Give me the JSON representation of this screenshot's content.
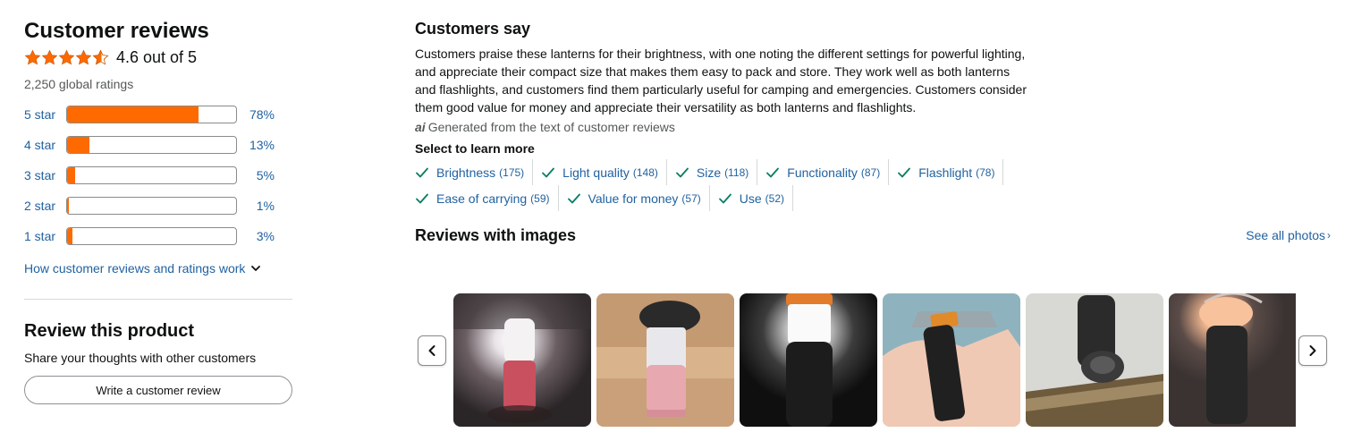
{
  "customer_reviews": {
    "title": "Customer reviews",
    "rating_text": "4.6 out of 5",
    "rating_value": 4.6,
    "global_ratings": "2,250 global ratings",
    "histogram": [
      {
        "label": "5 star",
        "pct": "78%",
        "value": 78
      },
      {
        "label": "4 star",
        "pct": "13%",
        "value": 13
      },
      {
        "label": "3 star",
        "pct": "5%",
        "value": 5
      },
      {
        "label": "2 star",
        "pct": "1%",
        "value": 1
      },
      {
        "label": "1 star",
        "pct": "3%",
        "value": 3
      }
    ],
    "how_link": "How customer reviews and ratings work"
  },
  "review_product": {
    "title": "Review this product",
    "subtitle": "Share your thoughts with other customers",
    "button": "Write a customer review"
  },
  "customers_say": {
    "title": "Customers say",
    "body": "Customers praise these lanterns for their brightness, with one noting the different settings for powerful lighting, and appreciate their compact size that makes them easy to pack and store. They work well as both lanterns and flashlights, and customers find them particularly useful for camping and emergencies. Customers consider them good value for money and appreciate their versatility as both lanterns and flashlights.",
    "ai_badge": "ai",
    "generated": "Generated from the text of customer reviews",
    "select_label": "Select to learn more",
    "chips_row1": [
      {
        "label": "Brightness",
        "count": "(175)"
      },
      {
        "label": "Light quality",
        "count": "(148)"
      },
      {
        "label": "Size",
        "count": "(118)"
      },
      {
        "label": "Functionality",
        "count": "(87)"
      },
      {
        "label": "Flashlight",
        "count": "(78)"
      }
    ],
    "chips_row2": [
      {
        "label": "Ease of carrying",
        "count": "(59)"
      },
      {
        "label": "Value for money",
        "count": "(57)"
      },
      {
        "label": "Use",
        "count": "(52)"
      }
    ]
  },
  "reviews_with_images": {
    "title": "Reviews with images",
    "see_all": "See all photos",
    "see_all_arrow": "›"
  },
  "colors": {
    "accent_orange": "#ff6a00",
    "link_blue": "#2162a1",
    "check_teal": "#067d62"
  },
  "icons": [
    "star-icon",
    "chevron-down-icon",
    "check-icon",
    "chevron-left-icon",
    "chevron-right-icon"
  ]
}
